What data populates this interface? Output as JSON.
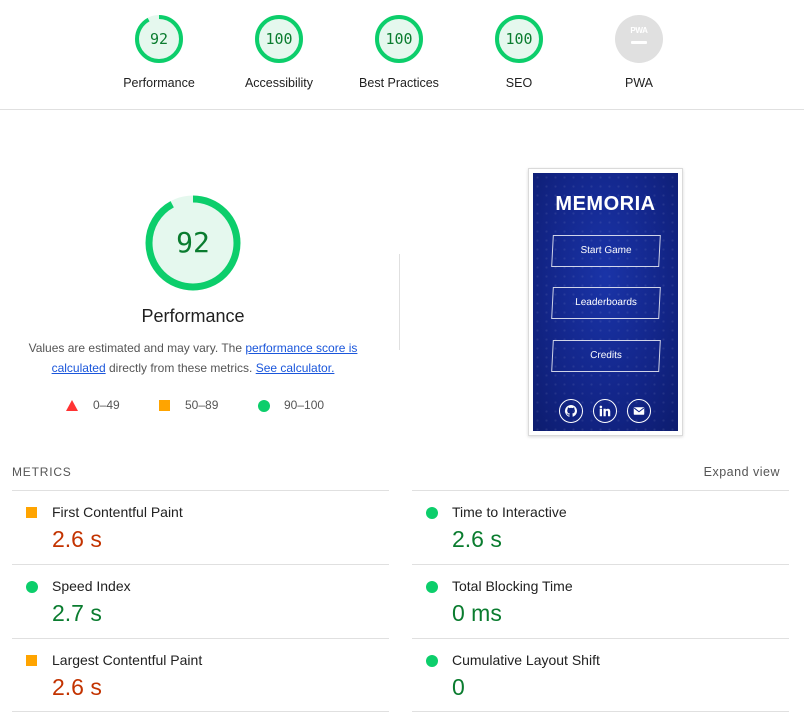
{
  "categories": [
    {
      "label": "Performance",
      "score": "92",
      "value": 92
    },
    {
      "label": "Accessibility",
      "score": "100",
      "value": 100
    },
    {
      "label": "Best Practices",
      "score": "100",
      "value": 100
    },
    {
      "label": "SEO",
      "score": "100",
      "value": 100
    },
    {
      "label": "PWA",
      "badge": "PWA"
    }
  ],
  "performance": {
    "score": "92",
    "value": 92,
    "title": "Performance",
    "desc_pre": "Values are estimated and may vary. The ",
    "desc_link1": "performance score is calculated",
    "desc_mid": " directly from these metrics. ",
    "desc_link2": "See calculator."
  },
  "legend": [
    {
      "shape": "triangle",
      "range": "0–49",
      "color": "#ff3333"
    },
    {
      "shape": "square",
      "range": "50–89",
      "color": "#ffa400"
    },
    {
      "shape": "circle",
      "range": "90–100",
      "color": "#0cce6b"
    }
  ],
  "screenshot": {
    "app_title": "MEMORIA",
    "buttons": [
      "Start Game",
      "Leaderboards",
      "Credits"
    ],
    "icons": [
      "github-icon",
      "linkedin-icon",
      "mail-icon"
    ]
  },
  "metrics": {
    "heading": "METRICS",
    "expand_label": "Expand view",
    "items": [
      {
        "name": "First Contentful Paint",
        "value": "2.6 s",
        "status": "average"
      },
      {
        "name": "Time to Interactive",
        "value": "2.6 s",
        "status": "pass"
      },
      {
        "name": "Speed Index",
        "value": "2.7 s",
        "status": "pass"
      },
      {
        "name": "Total Blocking Time",
        "value": "0 ms",
        "status": "pass"
      },
      {
        "name": "Largest Contentful Paint",
        "value": "2.6 s",
        "status": "average"
      },
      {
        "name": "Cumulative Layout Shift",
        "value": "0",
        "status": "pass"
      }
    ]
  },
  "colors": {
    "pass": "#0cce6b",
    "average": "#ffa400",
    "fail": "#ff3333",
    "pass_text": "#0a7c2f",
    "average_text": "#c33300"
  }
}
